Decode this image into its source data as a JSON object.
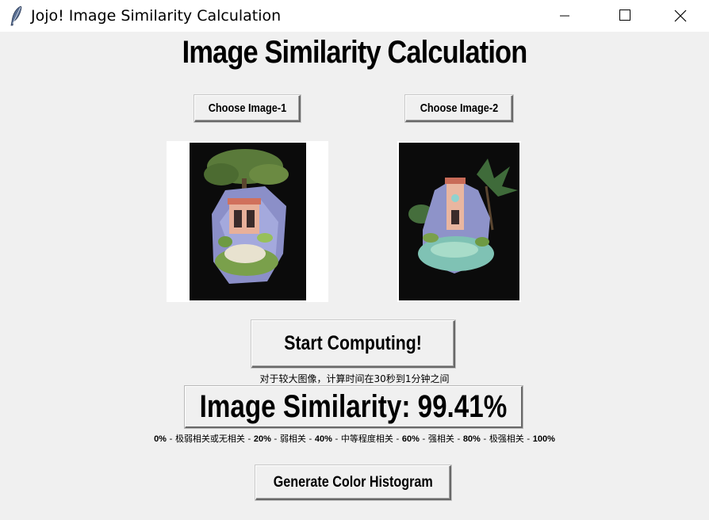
{
  "window": {
    "title": "Jojo! Image Similarity Calculation",
    "icon": "feather-icon",
    "controls": [
      "minimize-icon",
      "maximize-icon",
      "close-icon"
    ]
  },
  "heading": "Image Similarity Calculation",
  "choose_image_1_label": "Choose Image-1",
  "choose_image_2_label": "Choose Image-2",
  "start_label": "Start Computing!",
  "note": "对于较大图像，计算时间在30秒到1分钟之间",
  "result": "Image Similarity: 99.41%",
  "scale": {
    "p0": "0%",
    "l1": "极弱相关或无相关",
    "p20": "20%",
    "l2": "弱相关",
    "p40": "40%",
    "l3": "中等程度相关",
    "p60": "60%",
    "l4": "强相关",
    "p80": "80%",
    "l5": "极强相关",
    "p100": "100%"
  },
  "histogram_label": "Generate Color Histogram"
}
